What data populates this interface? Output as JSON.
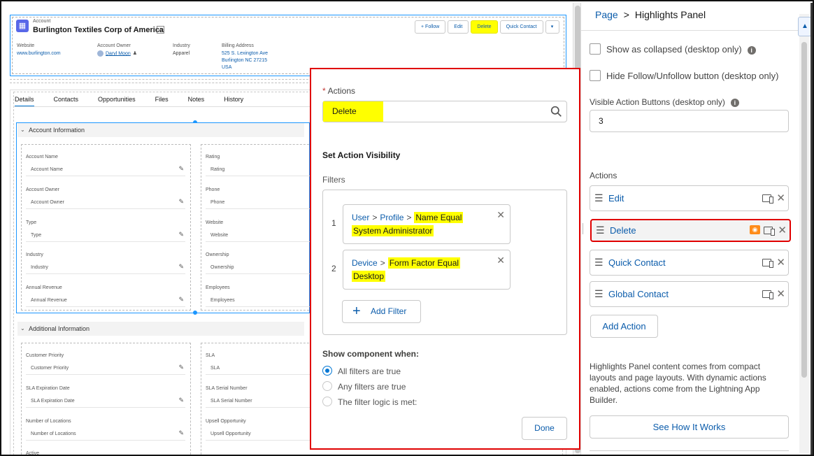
{
  "highlights": {
    "object_type": "Account",
    "account_name": "Burlington Textiles Corp of America",
    "buttons": [
      "Follow",
      "Edit",
      "Delete",
      "Quick Contact"
    ],
    "fields": [
      {
        "label": "Website",
        "value": "www.burlington.com"
      },
      {
        "label": "Account Owner",
        "value": "Daryl Moon"
      },
      {
        "label": "Industry",
        "value": "Apparel"
      },
      {
        "label": "Billing Address",
        "lines": [
          "525 S. Lexington Ave",
          "Burlington NC 27215",
          "USA"
        ]
      }
    ]
  },
  "tabs": [
    "Details",
    "Contacts",
    "Opportunities",
    "Files",
    "Notes",
    "History"
  ],
  "sections": [
    {
      "title": "Account Information",
      "left": [
        {
          "label": "Account Name",
          "value": "Account Name"
        },
        {
          "label": "Account Owner",
          "value": "Account Owner"
        },
        {
          "label": "Type",
          "value": "Type"
        },
        {
          "label": "Industry",
          "value": "Industry"
        },
        {
          "label": "Annual Revenue",
          "value": "Annual Revenue"
        }
      ],
      "right": [
        {
          "label": "Rating",
          "value": "Rating"
        },
        {
          "label": "Phone",
          "value": "Phone"
        },
        {
          "label": "Website",
          "value": "Website"
        },
        {
          "label": "Ownership",
          "value": "Ownership"
        },
        {
          "label": "Employees",
          "value": "Employees"
        }
      ]
    },
    {
      "title": "Additional Information",
      "left": [
        {
          "label": "Customer Priority",
          "value": "Customer Priority"
        },
        {
          "label": "SLA Expiration Date",
          "value": "SLA Expiration Date"
        },
        {
          "label": "Number of Locations",
          "value": "Number of Locations"
        },
        {
          "label": "Active",
          "value": ""
        }
      ],
      "right": [
        {
          "label": "SLA",
          "value": "SLA"
        },
        {
          "label": "SLA Serial Number",
          "value": "SLA Serial Number"
        },
        {
          "label": "Upsell Opportunity",
          "value": "Upsell Opportunity"
        }
      ]
    }
  ],
  "popover": {
    "actions_label": "Actions",
    "actions_value": "Delete",
    "visibility_title": "Set Action Visibility",
    "filters_label": "Filters",
    "filters": [
      {
        "num": "1",
        "path": [
          "User",
          "Profile"
        ],
        "cond1": "Name Equal",
        "cond2": "System Administrator"
      },
      {
        "num": "2",
        "path": [
          "Device"
        ],
        "cond1": "Form Factor Equal",
        "cond2": "Desktop"
      }
    ],
    "path_sep": ">",
    "add_filter": "Add Filter",
    "show_when": "Show component when:",
    "radios": [
      "All filters are true",
      "Any filters are true",
      "The filter logic is met:"
    ],
    "done": "Done"
  },
  "panel": {
    "breadcrumb_page": "Page",
    "breadcrumb_sep": ">",
    "breadcrumb_current": "Highlights Panel",
    "show_collapsed": "Show as collapsed (desktop only)",
    "hide_follow": "Hide Follow/Unfollow button (desktop only)",
    "visible_buttons_label": "Visible Action Buttons (desktop only)",
    "visible_buttons_value": "3",
    "actions_label": "Actions",
    "actions": [
      "Edit",
      "Delete",
      "Quick Contact",
      "Global Contact"
    ],
    "add_action": "Add Action",
    "help_text": "Highlights Panel content comes from compact layouts and page layouts. With dynamic actions enabled, actions come from the Lightning App Builder.",
    "see_how": "See How It Works"
  },
  "colors": {
    "brand": "#0176d3",
    "link": "#0b5cab",
    "highlight": "#ffff00",
    "callout_red": "#e00000",
    "visibility_icon": "#ff8c1a"
  }
}
